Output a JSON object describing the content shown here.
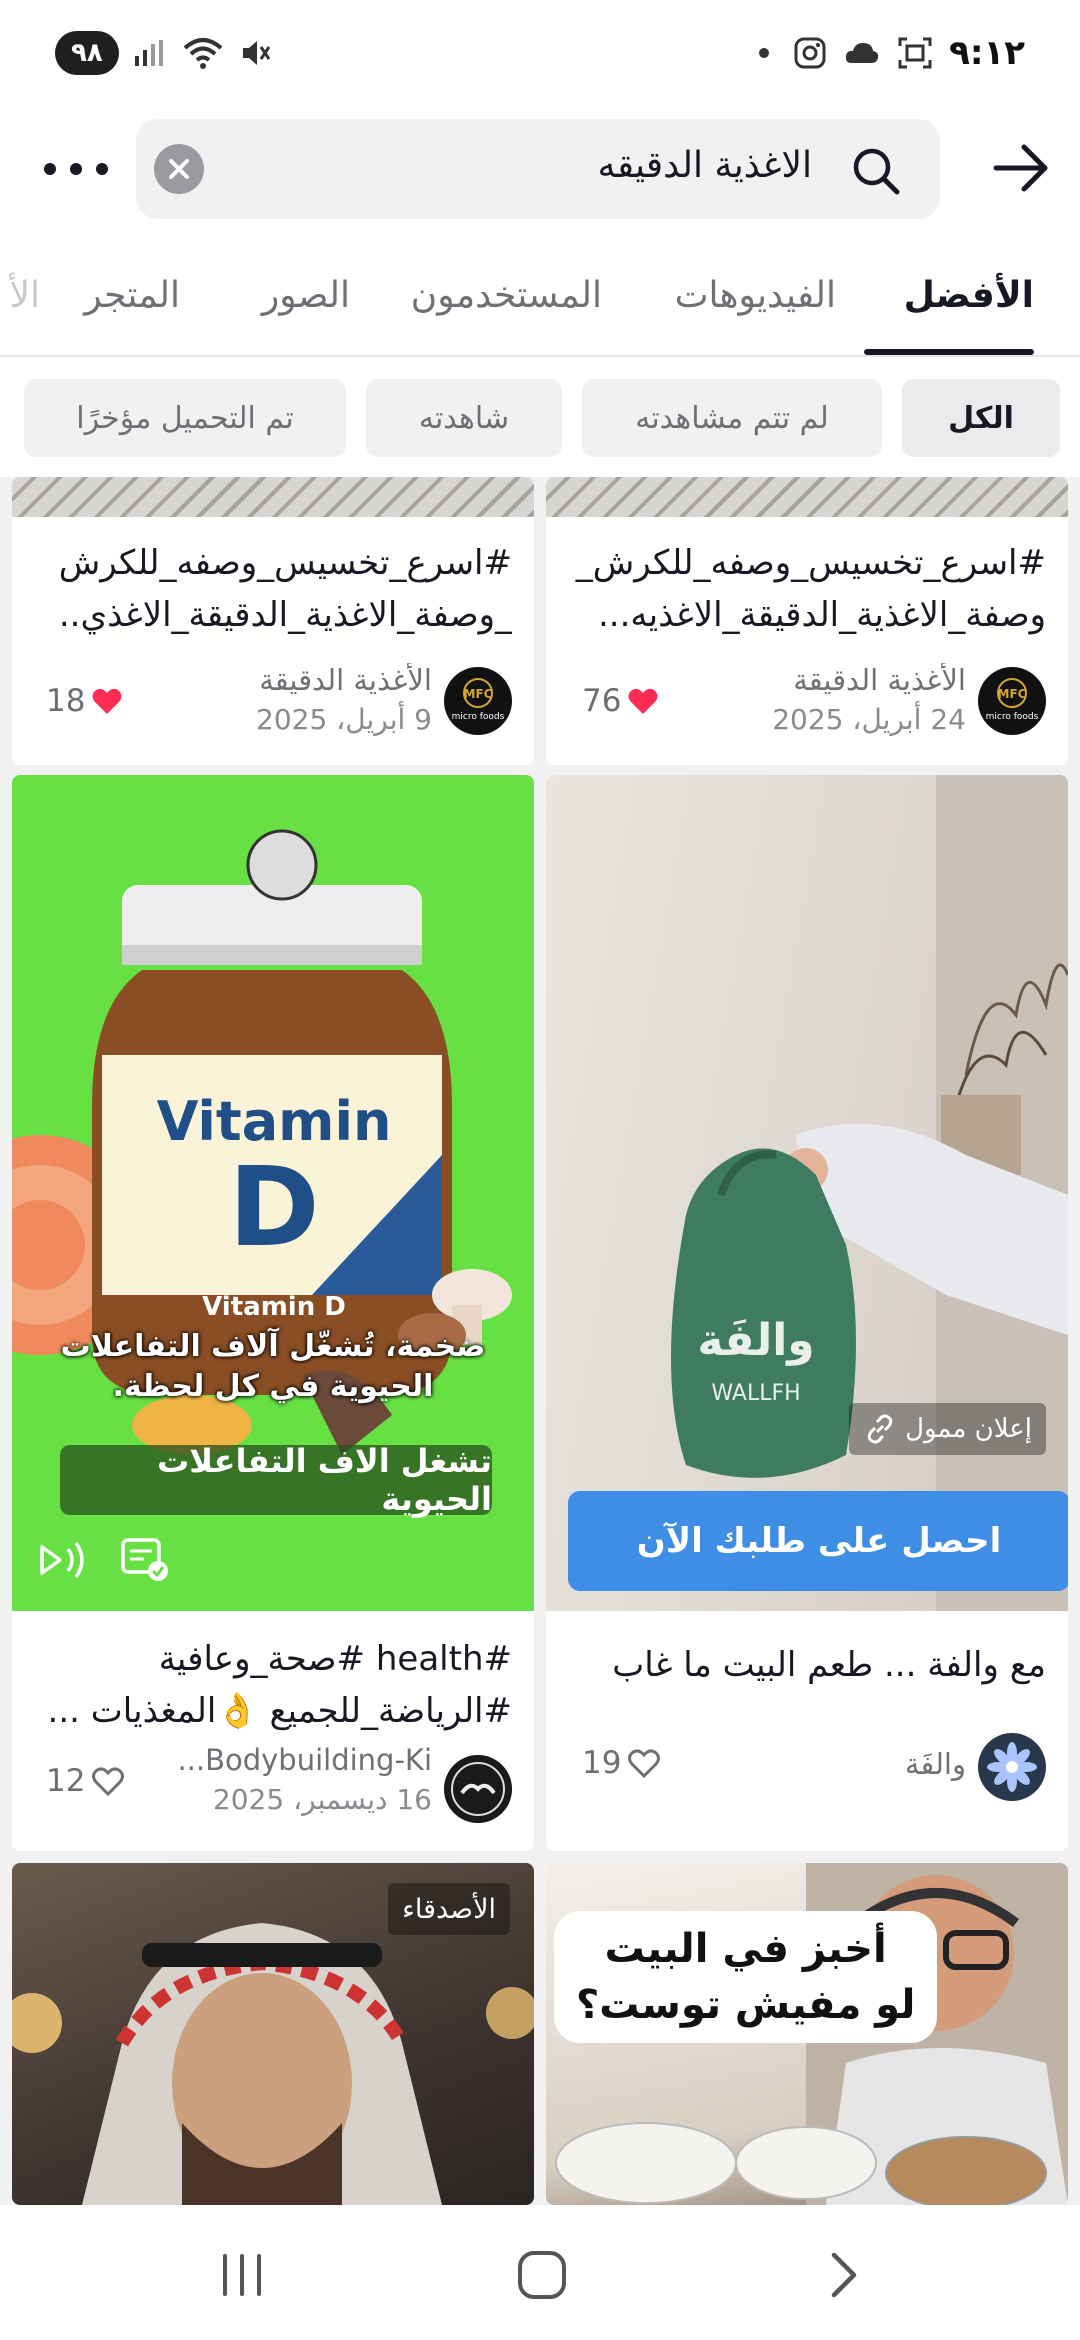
{
  "status_bar": {
    "time": "٩:١٢",
    "battery": "٩٨"
  },
  "search": {
    "query": "الاغذية الدقيقه"
  },
  "tabs": [
    {
      "label": "الأفضل",
      "active": true
    },
    {
      "label": "الفيديوهات",
      "active": false
    },
    {
      "label": "المستخدمون",
      "active": false
    },
    {
      "label": "الصور",
      "active": false
    },
    {
      "label": "المتجر",
      "active": false
    },
    {
      "label": "الأ",
      "active": false
    }
  ],
  "filters": [
    {
      "label": "الكل",
      "active": true
    },
    {
      "label": "لم تتم مشاهدته",
      "active": false
    },
    {
      "label": "شاهدته",
      "active": false
    },
    {
      "label": "تم التحميل مؤخرًا",
      "active": false
    }
  ],
  "cards": {
    "top_right": {
      "desc_line1": "#اسرع_تخسيس_وصفه_للكرش_",
      "desc_line2": "وصفة_الاغذية_الدقيقة_الاغذيه...",
      "author": "الأغذية الدقيقة",
      "date": "24 أبريل، 2025",
      "likes": "76",
      "avatar_text": "micro foods"
    },
    "top_left": {
      "desc_line1": "#اسرع_تخسيس_وصفه_للكرش",
      "desc_line2": "_وصفة_الاغذية_الدقيقة_الاغذي..",
      "author": "الأغذية الدقيقة",
      "date": "9 أبريل، 2025",
      "likes": "18",
      "avatar_text": "micro foods"
    },
    "vitamin": {
      "jar_title": "Vitamin",
      "jar_letter": "D",
      "jar_sub": "Vitamin D",
      "caption_line1": "ضخمة، تُشغّل آلاف التفاعلات",
      "caption_line2": "الحيوية في كل لحظة.",
      "cta": "تشغل الاف التفاعلات الحيوية",
      "desc_line1": "#health #صحة_وعافية",
      "desc_line2": "#الرياضة_للجميع 👌المغذيات ...",
      "author": "Bodybuilding-Ki...",
      "date": "16 ديسمبر، 2025",
      "likes": "12"
    },
    "ad": {
      "bag_text": "والفَة",
      "bag_sub": "WALLFH",
      "sponsored": "إعلان ممول",
      "button": "احصل على طلبك الآن",
      "desc_line1": "مع والفة ... طعم البيت ما غاب",
      "author": "والفَة",
      "likes": "19"
    },
    "friends": {
      "tag": "الأصدقاء"
    },
    "bread": {
      "bubble_line1": "أخبز في البيت",
      "bubble_line2": "لو مفيش توست؟"
    }
  },
  "colors": {
    "accent_red": "#fe2c55",
    "ad_button": "#3d8ee4",
    "vitamin_green": "#66e042"
  }
}
